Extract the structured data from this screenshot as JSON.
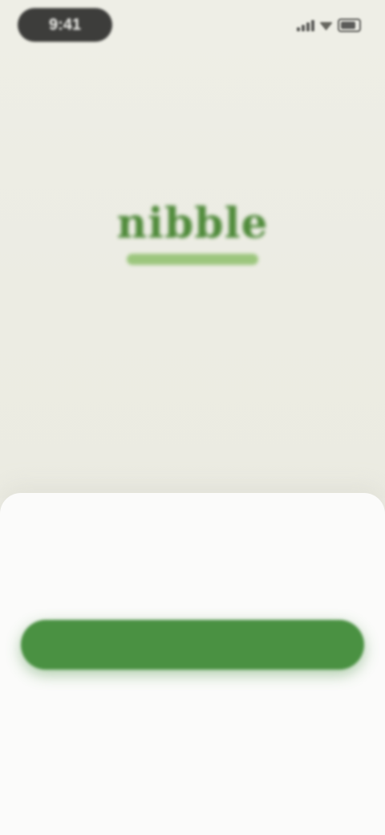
{
  "status_bar": {
    "time": "9:41",
    "signal": "signal-icon",
    "wifi": "wifi-icon",
    "battery": "battery-icon"
  },
  "brand": {
    "logo_text": "nibble",
    "logo_subtitle": "",
    "tagline": ""
  },
  "sheet": {
    "message": "",
    "subline": "",
    "continue_button": "",
    "skip_link": "",
    "legal_text": "",
    "legal_link_terms": "",
    "legal_link_privacy": ""
  },
  "colors": {
    "background": "#ecece4",
    "sheet": "#fbfbfa",
    "accent_green": "#4a9142",
    "logo_green": "#4f8a3a"
  }
}
